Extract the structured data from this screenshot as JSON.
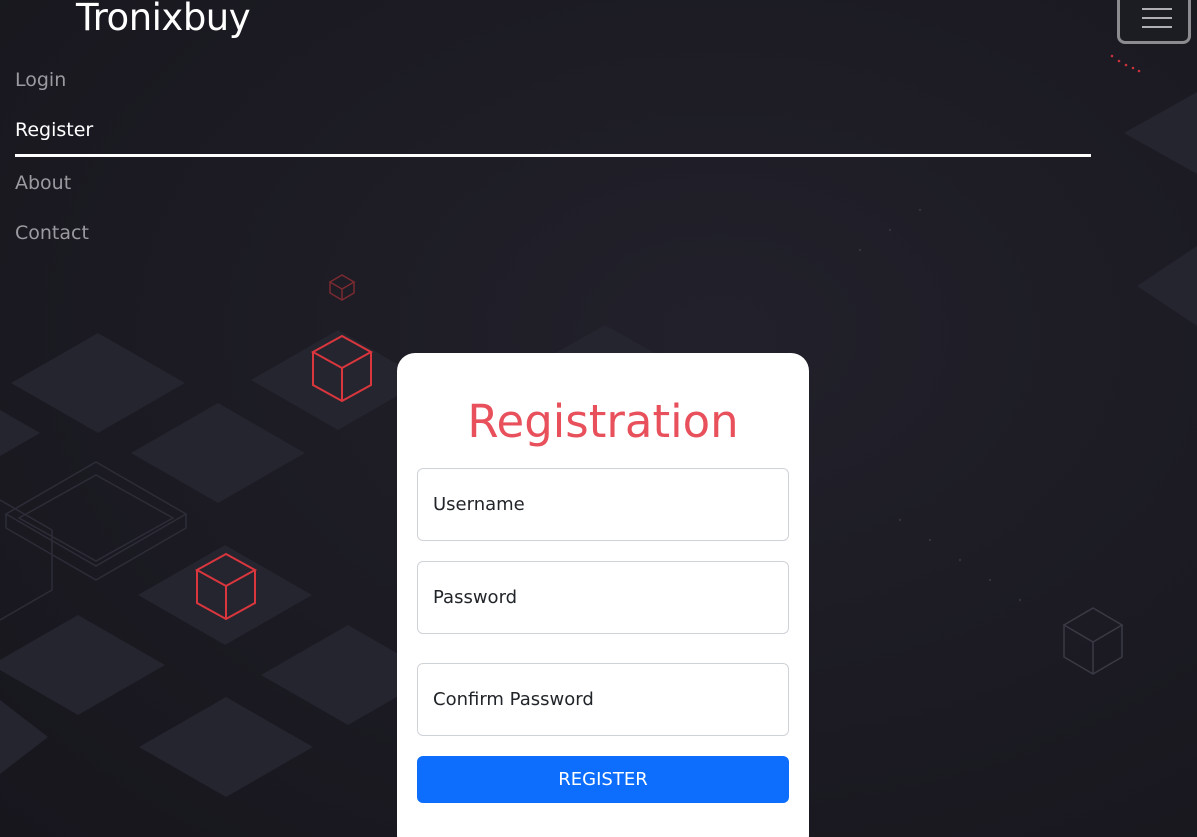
{
  "navbar": {
    "brand": "Tronixbuy",
    "toggler_icon": "hamburger-icon",
    "items": [
      {
        "label": "Login",
        "active": false
      },
      {
        "label": "Register",
        "active": true
      },
      {
        "label": "About",
        "active": false
      },
      {
        "label": "Contact",
        "active": false
      }
    ]
  },
  "form": {
    "title": "Registration",
    "fields": {
      "username": {
        "placeholder": "Username",
        "value": ""
      },
      "password": {
        "placeholder": "Password",
        "value": ""
      },
      "confirm_password": {
        "placeholder": "Confirm Password",
        "value": ""
      }
    },
    "submit_label": "REGISTER"
  },
  "colors": {
    "background": "#1c1b24",
    "accent_red": "#e8505b",
    "button_blue": "#0d6efd",
    "cube_red": "#d9363e"
  }
}
